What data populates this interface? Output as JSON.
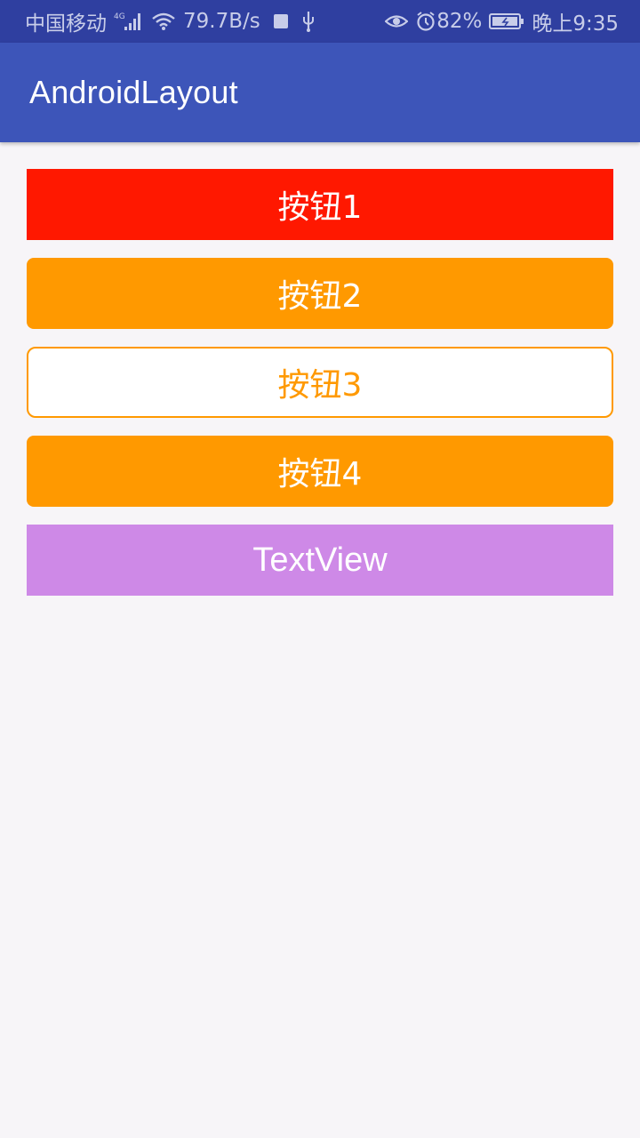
{
  "status_bar": {
    "carrier": "中国移动",
    "network_type": "4G",
    "speed": "79.7B/s",
    "battery": "82%",
    "time": "晚上9:35",
    "icons": [
      "signal-icon",
      "wifi-icon",
      "notification-square-icon",
      "usb-icon",
      "eye-icon",
      "alarm-icon",
      "battery-icon"
    ]
  },
  "app_bar": {
    "title": "AndroidLayout"
  },
  "buttons": [
    {
      "label": "按钮1",
      "bg": "#ff1800",
      "fg": "#ffffff"
    },
    {
      "label": "按钮2",
      "bg": "#ff9900",
      "fg": "#ffffff"
    },
    {
      "label": "按钮3",
      "bg": "#ffffff",
      "fg": "#ff9900"
    },
    {
      "label": "按钮4",
      "bg": "#ff9900",
      "fg": "#ffffff"
    }
  ],
  "textview": {
    "text": "TextView",
    "bg": "#ce89e7"
  },
  "colors": {
    "status_bar": "#2f3fa0",
    "app_bar": "#3d55b9",
    "background": "#f7f5f8"
  }
}
